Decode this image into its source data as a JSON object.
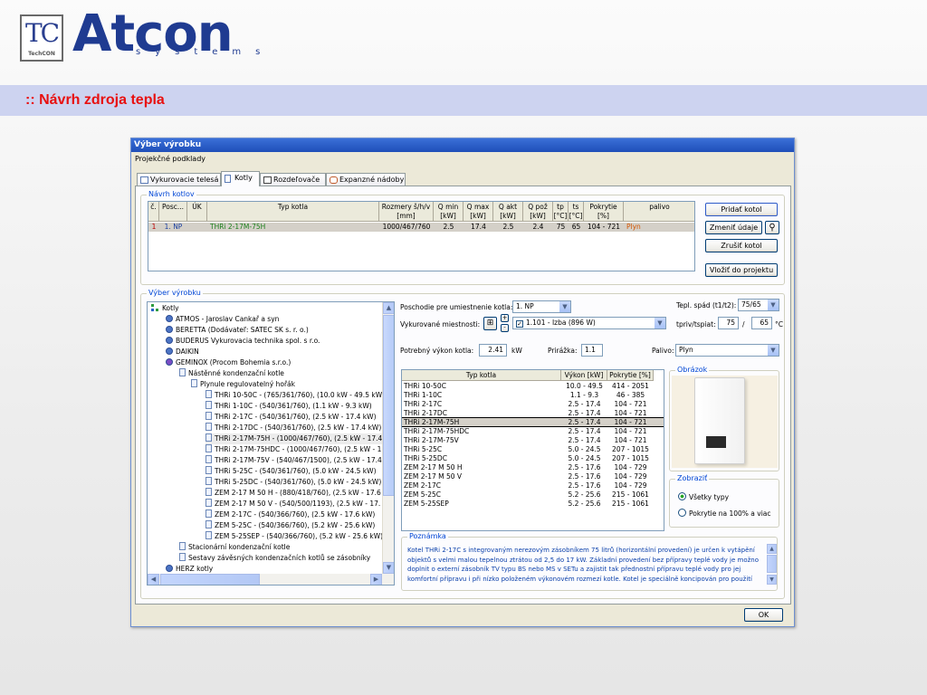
{
  "slide": {
    "logo_mark": "TC",
    "logo_caption": "TechCON",
    "brand_name": "Atcon",
    "brand_sub": "systems",
    "title": ":: Návrh zdroja tepla"
  },
  "dialog": {
    "title": "Výber výrobku",
    "menu_item": "Projekčné podklady",
    "tabs": [
      {
        "label": "Vykurovacie telesá",
        "active": false
      },
      {
        "label": "Kotly",
        "active": true
      },
      {
        "label": "Rozdeľovače",
        "active": false
      },
      {
        "label": "Expanzné nádoby",
        "active": false
      }
    ],
    "design": {
      "legend": "Návrh kotlov",
      "headers": [
        "č.",
        "Posc...",
        "ÚK",
        "Typ kotla",
        "Rozmery š/h/v [mm]",
        "Q min [kW]",
        "Q max [kW]",
        "Q akt [kW]",
        "Q pož [kW]",
        "tp [°C]",
        "ts [°C]",
        "Pokrytie [%]",
        "palivo"
      ],
      "row": {
        "no": "1",
        "floor": "1. NP",
        "uk": "",
        "type": "THRi 2-17M-75H",
        "dims": "1000/467/760",
        "qmin": "2.5",
        "qmax": "17.4",
        "qakt": "2.5",
        "qpoz": "2.4",
        "tp": "75",
        "ts": "65",
        "coverage": "104 - 721",
        "fuel": "Plyn"
      },
      "buttons": [
        "Pridať kotol",
        "Zmeniť údaje",
        "Zrušiť kotol",
        "Vložiť do projektu"
      ]
    },
    "selection": {
      "legend": "Výber výrobku",
      "tree": {
        "root": "Kotly",
        "manufacturers": [
          "ATMOS - Jaroslav Cankař a syn",
          "BERETTA (Dodávateľ: SATEC SK s. r. o.)",
          "BUDERUS Vykurovacia technika spol. s r.o.",
          "DAIKIN",
          "GEMINOX (Procom Bohemia s.r.o.)"
        ],
        "category": "Nástěnné kondenzační kotle",
        "subcategory": "Plynule regulovatelný hořák",
        "models": [
          "THRi 10-50C - (765/361/760), (10.0 kW - 49.5 kW",
          "THRi 1-10C - (540/361/760), (1.1 kW - 9.3 kW)",
          "THRi 2-17C  - (540/361/760), (2.5 kW - 17.4 kW)",
          "THRi 2-17DC - (540/361/760), (2.5 kW - 17.4 kW)",
          "THRi 2-17M-75H - (1000/467/760), (2.5 kW - 17.4",
          "THRi 2-17M-75HDC - (1000/467/760), (2.5 kW - 1",
          "THRi 2-17M-75V - (540/467/1500), (2.5 kW - 17.4",
          "THRi 5-25C - (540/361/760), (5.0 kW - 24.5 kW)",
          "THRi 5-25DC - (540/361/760), (5.0 kW - 24.5 kW)",
          "ZEM 2-17 M 50 H - (880/418/760), (2.5 kW - 17.6",
          "ZEM 2-17 M 50 V  - (540/500/1193), (2.5 kW - 17.",
          "ZEM 2-17C - (540/366/760), (2.5 kW - 17.6 kW)",
          "ZEM 5-25C - (540/366/760), (5.2 kW - 25.6 kW)",
          "ZEM 5-25SEP - (540/366/760), (5.2 kW - 25.6 kW)"
        ],
        "trailing": [
          "Stacionární kondenzační kotle",
          "Sestavy závěsných kondenzačních kotlů se zásobníky",
          "HERZ kotly"
        ]
      },
      "floor_label": "Poschodie pre umiestnenie kotla:",
      "floor_value": "1. NP",
      "rooms_label": "Vykurované miestnosti:",
      "room_value": "1.101 - Izba (896 W)",
      "temp_label": "Tepl. spád (t1/t2):",
      "temp_value": "75/65",
      "flow_label": "tpriv/tspiat:",
      "flow_value": "75",
      "return_value": "65",
      "unit_c": "°C",
      "slash": "/",
      "power_label": "Potrebný výkon kotla:",
      "power_value": "2.41",
      "power_unit": "kW",
      "surcharge_label": "Prirážka:",
      "surcharge_value": "1.1",
      "fuel_label": "Palivo:",
      "fuel_value": "Plyn",
      "table": {
        "headers": [
          "Typ kotla",
          "Výkon [kW]",
          "Pokrytie [%]"
        ],
        "rows": [
          [
            "THRi 10-50C",
            "10.0 - 49.5",
            "414 - 2051"
          ],
          [
            "THRi 1-10C",
            "1.1 - 9.3",
            "46 - 385"
          ],
          [
            "THRi 2-17C",
            "2.5 - 17.4",
            "104 - 721"
          ],
          [
            "THRi 2-17DC",
            "2.5 - 17.4",
            "104 - 721"
          ],
          [
            "THRi 2-17M-75H",
            "2.5 - 17.4",
            "104 - 721"
          ],
          [
            "THRi 2-17M-75HDC",
            "2.5 - 17.4",
            "104 - 721"
          ],
          [
            "THRi 2-17M-75V",
            "2.5 - 17.4",
            "104 - 721"
          ],
          [
            "THRi 5-25C",
            "5.0 - 24.5",
            "207 - 1015"
          ],
          [
            "THRi 5-25DC",
            "5.0 - 24.5",
            "207 - 1015"
          ],
          [
            "ZEM 2-17 M 50 H",
            "2.5 - 17.6",
            "104 - 729"
          ],
          [
            "ZEM 2-17 M 50 V",
            "2.5 - 17.6",
            "104 - 729"
          ],
          [
            "ZEM 2-17C",
            "2.5 - 17.6",
            "104 - 729"
          ],
          [
            "ZEM 5-25C",
            "5.2 - 25.6",
            "215 - 1061"
          ],
          [
            "ZEM 5-25SEP",
            "5.2 - 25.6",
            "215 - 1061"
          ]
        ],
        "selected_index": 4
      },
      "image_legend": "Obrázok",
      "show_legend": "Zobraziť",
      "show_options": [
        "Všetky typy",
        "Pokrytie na 100% a viac"
      ],
      "show_selected": 0,
      "note_legend": "Poznámka",
      "note_text": "Kotel THRi 2-17C s integrovaným nerezovým zásobníkem 75 litrů (horizontální provedení) je určen k vytápění objektů s velmi malou tepelnou ztrátou od 2,5 do 17 kW. Základní provedení bez přípravy teplé vody je možno doplnit o externí zásobník TV typu BS nebo MS v SETu a zajistit tak přednostní přípravu teplé vody pro jej komfortní přípravu i při nízko položeném výkonovém rozmezí kotle. Kotel je speciálně koncipován pro použití"
    },
    "ok_label": "OK"
  },
  "colors": {
    "accent": "#1f3b91",
    "title_red": "#e81010",
    "title_band": "#cdd3f0",
    "xp_title": "#2456c4",
    "legend_blue": "#0046d5",
    "fuel_orange": "#d35400",
    "type_green": "#1a7f1a"
  },
  "icons": [
    "tc-logo-icon",
    "tab-radiator-icon",
    "tab-boiler-icon",
    "tab-manifold-icon",
    "tab-expansion-icon",
    "search-icon",
    "tree-root-icon",
    "manufacturer-icon",
    "folder-icon",
    "boiler-model-icon",
    "dropdown-arrow-icon",
    "room-add-icon",
    "spin-icon",
    "scroll-arrow-icon",
    "boiler-image"
  ]
}
